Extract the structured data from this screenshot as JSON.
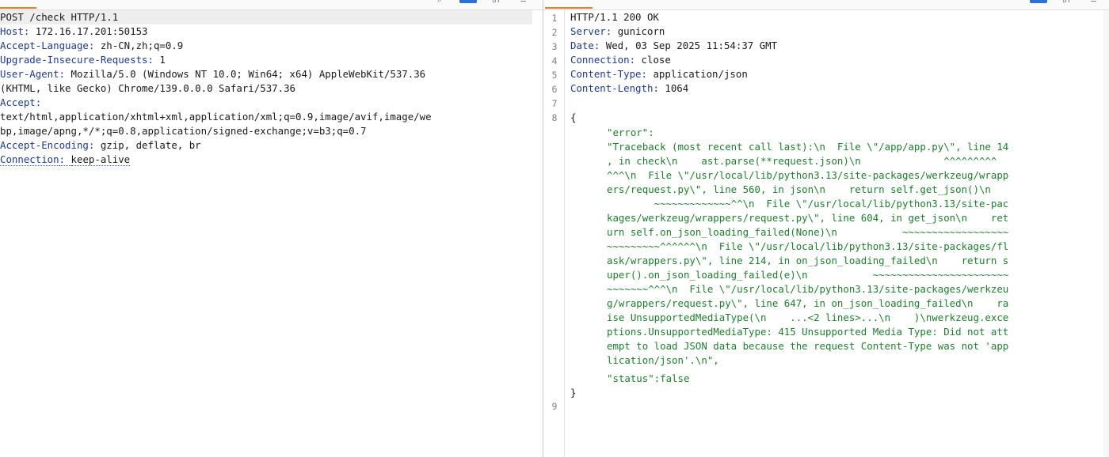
{
  "request": {
    "request_line": "POST /check HTTP/1.1",
    "headers": [
      {
        "name": "Host",
        "value": "172.16.17.201:50153"
      },
      {
        "name": "Accept-Language",
        "value": "zh-CN,zh;q=0.9"
      },
      {
        "name": "Upgrade-Insecure-Requests",
        "value": "1"
      },
      {
        "name": "User-Agent",
        "value": "Mozilla/5.0 (Windows NT 10.0; Win64; x64) AppleWebKit/537.36"
      },
      {
        "name": "",
        "value": "(KHTML, like Gecko) Chrome/139.0.0.0 Safari/537.36"
      },
      {
        "name": "Accept",
        "value": ""
      },
      {
        "name": "",
        "value": "text/html,application/xhtml+xml,application/xml;q=0.9,image/avif,image/we"
      },
      {
        "name": "",
        "value": "bp,image/apng,*/*;q=0.8,application/signed-exchange;v=b3;q=0.7"
      },
      {
        "name": "Accept-Encoding",
        "value": "gzip, deflate, br"
      },
      {
        "name": "Connection",
        "value": "keep-alive"
      }
    ]
  },
  "response": {
    "line_numbers": [
      "1",
      "2",
      "3",
      "4",
      "5",
      "6",
      "7",
      "8",
      "9"
    ],
    "status_line": "HTTP/1.1 200 OK",
    "headers": [
      {
        "name": "Server",
        "value": "gunicorn"
      },
      {
        "name": "Date",
        "value": "Wed, 03 Sep 2025 11:54:37 GMT"
      },
      {
        "name": "Connection",
        "value": "close"
      },
      {
        "name": "Content-Type",
        "value": "application/json"
      },
      {
        "name": "Content-Length",
        "value": "1064"
      }
    ],
    "body": {
      "open_brace": "{",
      "close_brace": "}",
      "error_key": "\"error\":",
      "error_value_lines": [
        "\"Traceback (most recent call last):\\n  File \\\"/app/app.py\\\", line 14",
        ", in check\\n    ast.parse(**request.json)\\n              ^^^^^^^^^",
        "^^^\\n  File \\\"/usr/local/lib/python3.13/site-packages/werkzeug/wrapp",
        "ers/request.py\\\", line 560, in json\\n    return self.get_json()\\n",
        "        ~~~~~~~~~~~~~^^\\n  File \\\"/usr/local/lib/python3.13/site-pac",
        "kages/werkzeug/wrappers/request.py\\\", line 604, in get_json\\n    ret",
        "urn self.on_json_loading_failed(None)\\n           ~~~~~~~~~~~~~~~~~~",
        "~~~~~~~~~^^^^^^\\n  File \\\"/usr/local/lib/python3.13/site-packages/fl",
        "ask/wrappers.py\\\", line 214, in on_json_loading_failed\\n    return s",
        "uper().on_json_loading_failed(e)\\n           ~~~~~~~~~~~~~~~~~~~~~~~",
        "~~~~~~~^^^\\n  File \\\"/usr/local/lib/python3.13/site-packages/werkzeu",
        "g/wrappers/request.py\\\", line 647, in on_json_loading_failed\\n    ra",
        "ise UnsupportedMediaType(\\n    ...<2 lines>...\\n    )\\nwerkzeug.exce",
        "ptions.UnsupportedMediaType: 415 Unsupported Media Type: Did not att",
        "empt to load JSON data because the request Content-Type was not 'app",
        "lication/json'.\\n\","
      ],
      "status_key": "\"status\":",
      "status_value": "false"
    }
  },
  "colors": {
    "tab_underline": "#f07a2a",
    "header_name": "#1e3a8a",
    "json_green": "#1e7d2d",
    "highlight_row": "#eeeeee",
    "blue_button": "#2f6fd6"
  }
}
